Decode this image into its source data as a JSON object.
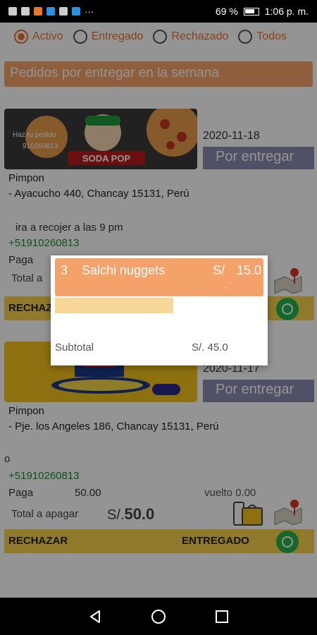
{
  "status_bar": {
    "battery": "69 %",
    "time": "1:06 p. m."
  },
  "filters": [
    {
      "label": "Activo",
      "selected": true
    },
    {
      "label": "Entregado",
      "selected": false
    },
    {
      "label": "Rechazado",
      "selected": false
    },
    {
      "label": "Todos",
      "selected": false
    }
  ],
  "week_header": "Pedidos por entregar en la semana",
  "orders": [
    {
      "banner_text": "Haz tu pedido",
      "banner_phone": "910260813",
      "banner_brand": "SODA POP",
      "date": "2020-11-18",
      "status": "Por entregar",
      "name": "Pimpon",
      "address": "- Ayacucho 440, Chancay 15131, Perú",
      "note": "ira a recojer a las 9 pm",
      "phone": "+51910260813",
      "paga_label": "Paga",
      "total_label": "Total a",
      "reject_label": "RECHAZ"
    },
    {
      "date": "2020-11-17",
      "status": "Por entregar",
      "name": "Pimpon",
      "address": "- Pje. los Angeles 186, Chancay 15131, Perú",
      "note": "o",
      "phone": "+51910260813",
      "paga_label": "Paga",
      "paga_value": "50.00",
      "vuelto": "vuelto 0.00",
      "total_label": "Total a apagar",
      "total_currency": "S/.",
      "total_value": "50.0",
      "reject_label": "RECHAZAR",
      "deliver_label": "ENTREGADO"
    }
  ],
  "dialog": {
    "qty": "3",
    "item": "Salchi nuggets",
    "currency": "S/",
    "price": "15.0",
    "dot": ".",
    "subtotal_label": "Subtotal",
    "subtotal_value": "S/. 45.0"
  },
  "colors": {
    "accent": "#e8732b",
    "header_bg": "#f5a26a",
    "status_btn": "#8a8ab0",
    "action_bar": "#f8d04a",
    "whatsapp": "#25b24a",
    "phone_green": "#1c8a2e"
  }
}
